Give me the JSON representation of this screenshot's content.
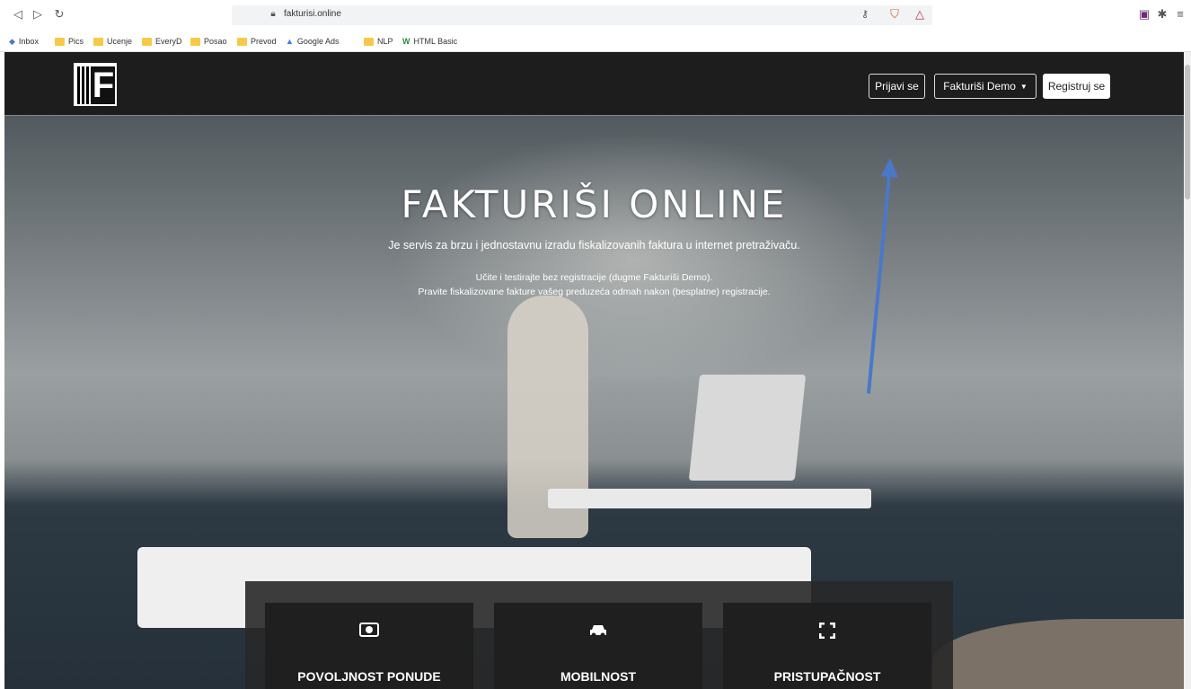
{
  "browser": {
    "url": "fakturisi.online",
    "bookmarks": [
      "Inbox",
      "Pics",
      "Ucenje",
      "EveryD",
      "Posao",
      "Prevod",
      "Google Ads",
      "NLP",
      "HTML Basic"
    ]
  },
  "nav": {
    "login": "Prijavi se",
    "demo": "Fakturiši Demo",
    "register": "Registruj se"
  },
  "hero": {
    "title": "FAKTURIŠI ONLINE",
    "subtitle": "Je servis za brzu i jednostavnu izradu fiskalizovanih faktura u internet pretraživaču.",
    "line1": "Učite i testirajte bez registracije (dugme Fakturiši Demo).",
    "line2": "Pravite fiskalizovane fakture vašeg preduzeća odmah nakon (besplatne) registracije."
  },
  "features": [
    {
      "label": "POVOLJNOST PONUDE",
      "icon": "money-icon"
    },
    {
      "label": "MOBILNOST",
      "icon": "car-icon"
    },
    {
      "label": "PRISTUPAČNOST",
      "icon": "expand-icon"
    }
  ],
  "colors": {
    "navbar": "#1d1d1d",
    "annotation_arrow": "#4a78c9"
  }
}
